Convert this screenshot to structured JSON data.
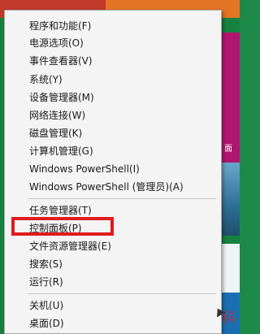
{
  "background": {
    "side_label": "面",
    "watermark_text": "电脑百科"
  },
  "menu": {
    "items": [
      {
        "label": "程序和功能(F)"
      },
      {
        "label": "电源选项(O)"
      },
      {
        "label": "事件查看器(V)"
      },
      {
        "label": "系统(Y)"
      },
      {
        "label": "设备管理器(M)"
      },
      {
        "label": "网络连接(W)"
      },
      {
        "label": "磁盘管理(K)"
      },
      {
        "label": "计算机管理(G)"
      },
      {
        "label": "Windows PowerShell(I)"
      },
      {
        "label": "Windows PowerShell (管理员)(A)"
      },
      {
        "label": "任务管理器(T)"
      },
      {
        "label": "控制面板(P)"
      },
      {
        "label": "文件资源管理器(E)"
      },
      {
        "label": "搜索(S)"
      },
      {
        "label": "运行(R)"
      },
      {
        "label": "关机(U)"
      },
      {
        "label": "桌面(D)"
      }
    ]
  },
  "colors": {
    "highlight": "#e01b1b"
  }
}
